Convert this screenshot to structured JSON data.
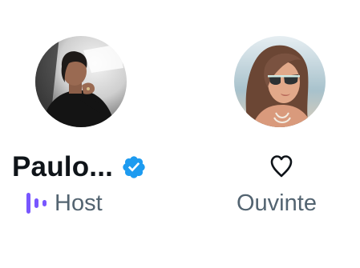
{
  "participants": {
    "host": {
      "display_name": "Paulo...",
      "role_label": "Host",
      "verified": true,
      "avatar_icon": "avatar-photo",
      "verified_icon": "verified-badge-icon",
      "role_icon": "host-speaking-bars-icon"
    },
    "listener": {
      "role_label": "Ouvinte",
      "avatar_icon": "avatar-photo",
      "reaction_icon": "heart-outline-icon"
    }
  },
  "colors": {
    "text_primary": "#0f1419",
    "text_secondary": "#536471",
    "verified_blue": "#1d9bf0",
    "host_purple": "#7856ff"
  }
}
